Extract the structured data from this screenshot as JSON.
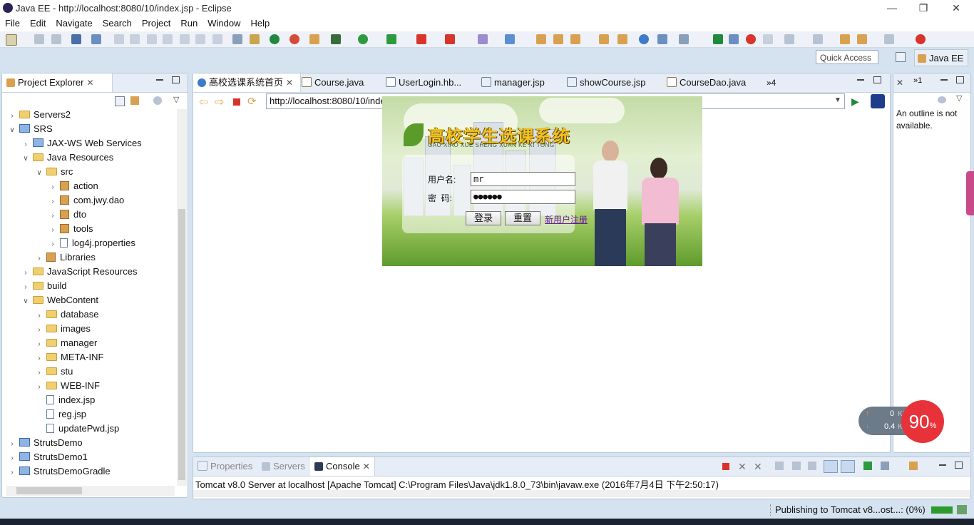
{
  "window": {
    "title": "Java EE - http://localhost:8080/10/index.jsp - Eclipse",
    "controls": [
      "—",
      "❐",
      "✕"
    ]
  },
  "menu": [
    "File",
    "Edit",
    "Navigate",
    "Search",
    "Project",
    "Run",
    "Window",
    "Help"
  ],
  "toolbar": {
    "quick_access": "Quick Access",
    "perspective": "Java EE"
  },
  "project_explorer": {
    "tab_label": "Project Explorer",
    "tree": [
      {
        "label": "Servers2",
        "icon": "folder",
        "expanded": false,
        "depth": 0
      },
      {
        "label": "SRS",
        "icon": "project",
        "expanded": true,
        "depth": 0
      },
      {
        "label": "JAX-WS Web Services",
        "icon": "webservice",
        "expanded": false,
        "depth": 1
      },
      {
        "label": "Java Resources",
        "icon": "java-resources",
        "expanded": true,
        "depth": 1
      },
      {
        "label": "src",
        "icon": "source-folder",
        "expanded": true,
        "depth": 2
      },
      {
        "label": "action",
        "icon": "package",
        "expanded": false,
        "depth": 3
      },
      {
        "label": "com.jwy.dao",
        "icon": "package",
        "expanded": false,
        "depth": 3
      },
      {
        "label": "dto",
        "icon": "package",
        "expanded": false,
        "depth": 3
      },
      {
        "label": "tools",
        "icon": "package",
        "expanded": false,
        "depth": 3
      },
      {
        "label": "log4j.properties",
        "icon": "properties-file",
        "expanded": false,
        "depth": 3
      },
      {
        "label": "Libraries",
        "icon": "library",
        "expanded": false,
        "depth": 2
      },
      {
        "label": "JavaScript Resources",
        "icon": "js-resources",
        "expanded": false,
        "depth": 1
      },
      {
        "label": "build",
        "icon": "folder",
        "expanded": false,
        "depth": 1
      },
      {
        "label": "WebContent",
        "icon": "folder",
        "expanded": true,
        "depth": 1
      },
      {
        "label": "database",
        "icon": "folder",
        "expanded": false,
        "depth": 2
      },
      {
        "label": "images",
        "icon": "folder",
        "expanded": false,
        "depth": 2
      },
      {
        "label": "manager",
        "icon": "folder",
        "expanded": false,
        "depth": 2
      },
      {
        "label": "META-INF",
        "icon": "folder",
        "expanded": false,
        "depth": 2
      },
      {
        "label": "stu",
        "icon": "folder",
        "expanded": false,
        "depth": 2
      },
      {
        "label": "WEB-INF",
        "icon": "folder",
        "expanded": false,
        "depth": 2
      },
      {
        "label": "index.jsp",
        "icon": "jsp-file",
        "expanded": null,
        "depth": 2
      },
      {
        "label": "reg.jsp",
        "icon": "jsp-file",
        "expanded": null,
        "depth": 2
      },
      {
        "label": "updatePwd.jsp",
        "icon": "jsp-file",
        "expanded": null,
        "depth": 2
      },
      {
        "label": "StrutsDemo",
        "icon": "project",
        "expanded": false,
        "depth": 0
      },
      {
        "label": "StrutsDemo1",
        "icon": "project",
        "expanded": false,
        "depth": 0
      },
      {
        "label": "StrutsDemoGradle",
        "icon": "project",
        "expanded": false,
        "depth": 0
      }
    ]
  },
  "editor": {
    "tabs": [
      {
        "label": "高校选课系统首页",
        "active": true
      },
      {
        "label": "Course.java",
        "active": false
      },
      {
        "label": "UserLogin.hb...",
        "active": false
      },
      {
        "label": "manager.jsp",
        "active": false
      },
      {
        "label": "showCourse.jsp",
        "active": false
      },
      {
        "label": "CourseDao.java",
        "active": false
      }
    ],
    "overflow_count": "»4",
    "url": "http://localhost:8080/10/index.jsp"
  },
  "login_page": {
    "title_cn": "高校学生选课系统",
    "title_pinyin": "GAO XIAO XUE SHENG XUAN KE XI TONG",
    "username_label": "用户名:",
    "password_label": "密  码:",
    "username_value": "mr",
    "password_value": "●●●●●●",
    "login_button": "登录",
    "reset_button": "重置",
    "register_link": "新用户注册"
  },
  "outline": {
    "tab_label": "»1",
    "message": "An outline is not available."
  },
  "bottom_panel": {
    "tabs": [
      "Properties",
      "Servers",
      "Console"
    ],
    "active_tab": "Console",
    "console_text": "Tomcat v8.0 Server at localhost [Apache Tomcat] C:\\Program Files\\Java\\jdk1.8.0_73\\bin\\javaw.exe (2016年7月4日 下午2:50:17)"
  },
  "status_bar": {
    "text": "Publishing to Tomcat v8...ost...: (0%)"
  },
  "net_widget": {
    "up": "0",
    "up_unit": "K/s",
    "down": "0.4",
    "down_unit": "K/s",
    "percent": "90",
    "percent_sign": "%"
  },
  "colors": {
    "accent": "#3e6aa6",
    "chrome_bg": "#d5e2ef",
    "tab_bg": "#e6edf6",
    "red_badge": "#e8323a"
  }
}
